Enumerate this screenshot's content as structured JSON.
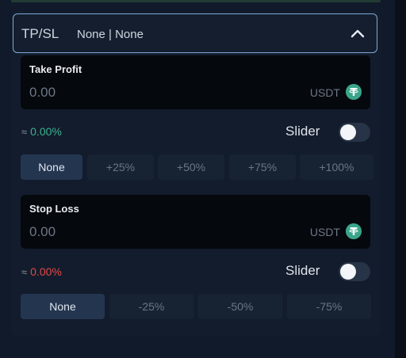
{
  "header": {
    "title": "TP/SL",
    "summary": "None | None",
    "toggle_icon": "chevron-up-icon"
  },
  "take_profit": {
    "label": "Take Profit",
    "value": "0.00",
    "currency": "USDT",
    "currency_icon": "tether-icon",
    "approx_symbol": "≈",
    "percent": "0.00%",
    "percent_color": "#3cb28e",
    "slider_label": "Slider",
    "slider_on": false,
    "presets": [
      "None",
      "+25%",
      "+50%",
      "+75%",
      "+100%"
    ],
    "selected": "None"
  },
  "stop_loss": {
    "label": "Stop Loss",
    "value": "0.00",
    "currency": "USDT",
    "currency_icon": "tether-icon",
    "approx_symbol": "≈",
    "percent": "0.00%",
    "percent_color": "#e2494a",
    "slider_label": "Slider",
    "slider_on": false,
    "presets": [
      "None",
      "-25%",
      "-50%",
      "-75%"
    ],
    "selected": "None"
  }
}
